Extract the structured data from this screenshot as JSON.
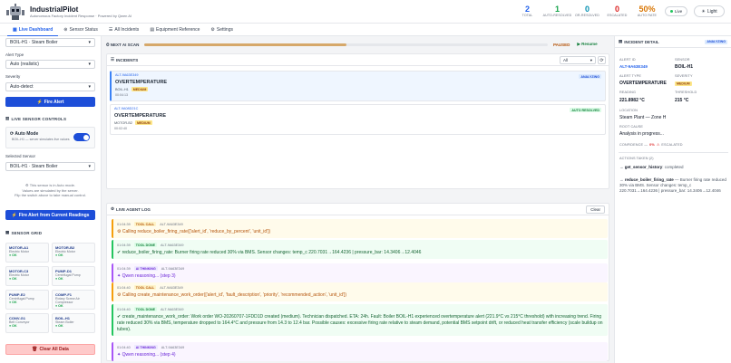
{
  "app": {
    "title": "IndustrialPilot",
    "subtitle": "Autonomous Factory Incident Response · Powered by Qwen AI"
  },
  "stats": [
    {
      "value": "2",
      "label": "TOTAL",
      "color": "#2563eb"
    },
    {
      "value": "1",
      "label": "AUTO-RESOLVED",
      "color": "#16a34a"
    },
    {
      "value": "0",
      "label": "OR-RESOLVED",
      "color": "#0891b2"
    },
    {
      "value": "0",
      "label": "ESCALATED",
      "color": "#dc2626"
    },
    {
      "value": "50%",
      "label": "AUTO RATE",
      "color": "#d97706"
    }
  ],
  "header": {
    "live_label": "Live",
    "theme_label": "Light"
  },
  "tabs": [
    "Live Dashboard",
    "Sensor Status",
    "All Incidents",
    "Equipment Reference",
    "Settings"
  ],
  "sidebar": {
    "equipment_select": "BOIL-H1 · Steam Boiler",
    "alert_type_label": "Alert Type",
    "alert_type_value": "Auto (realistic)",
    "severity_label": "Severity",
    "severity_value": "Auto-detect",
    "fire_alert_label": "Fire Alert",
    "live_controls_title": "LIVE SENSOR CONTROLS",
    "auto_mode_label": "Auto Mode",
    "auto_mode_desc": "BOIL-H1 — server simulates live values",
    "selected_sensor_label": "Selected Sensor",
    "selected_sensor_value": "BOIL-H1 · Steam Boiler",
    "note_line1": "This sensor is in Auto mode.",
    "note_line2": "Values are simulated by the server.",
    "note_line3": "Flip the switch above to take manual control.",
    "fire_current_label": "Fire Alert from Current Readings",
    "sensor_grid_title": "SENSOR GRID",
    "sensor_grid": [
      {
        "id": "MOTOR-A1",
        "type": "Electric Motor",
        "status": "OK"
      },
      {
        "id": "MOTOR-B2",
        "type": "Electric Motor",
        "status": "OK"
      },
      {
        "id": "MOTOR-C3",
        "type": "Electric Motor",
        "status": "OK"
      },
      {
        "id": "PUMP-D1",
        "type": "Centrifugal Pump",
        "status": "OK"
      },
      {
        "id": "PUMP-E2",
        "type": "Centrifugal Pump",
        "status": "OK"
      },
      {
        "id": "COMP-F1",
        "type": "Rotary Screw Air Compressor",
        "status": "OK"
      },
      {
        "id": "CONV-G1",
        "type": "Belt Conveyor",
        "status": "OK"
      },
      {
        "id": "BOIL-H1",
        "type": "Steam Boiler",
        "status": "OK"
      }
    ],
    "clear_label": "Clear All Data"
  },
  "scan": {
    "label": "NEXT AI SCAN",
    "progress": 0.5,
    "status": "PAUSED",
    "resume_label": "Resume"
  },
  "incidents": {
    "title": "INCIDENTS",
    "filter_value": "All",
    "items": [
      {
        "id": "ALT-9A63E349",
        "title": "OVERTEMPERATURE",
        "equipment": "BOIL-H1",
        "severity": "MEDIUM",
        "time": "00:04:13",
        "status": "ANALYZING"
      },
      {
        "id": "ALT-9A08D21C",
        "title": "OVERTEMPERATURE",
        "equipment": "MOTOR-B2",
        "severity": "MEDIUM",
        "time": "00:02:40",
        "status": "AUTO RESOLVED"
      }
    ]
  },
  "log": {
    "title": "LIVE AGENT LOG",
    "clear_label": "Clear",
    "entries": [
      {
        "time": "01:04:39",
        "tag": "TOOL CALL",
        "id": "ALT-9A63E349",
        "kind": "tool",
        "msg": "Calling reduce_boiler_firing_rate(['alert_id', 'reduce_by_percent', 'unit_id'])"
      },
      {
        "time": "01:04:39",
        "tag": "TOOL DONE",
        "id": "ALT-9A63E349",
        "kind": "done",
        "msg": "reduce_boiler_firing_rate: Burner firing rate reduced 30% via BMS. Sensor changes: temp_c 220.7031→164.4236 | pressure_bar: 14.3406→12.4046"
      },
      {
        "time": "01:04:39",
        "tag": "AI THINKING",
        "id": "ALT-9A63E349",
        "kind": "ai",
        "msg": "Qwen reasoning... (step 3)"
      },
      {
        "time": "01:04:40",
        "tag": "TOOL CALL",
        "id": "ALT-9A63E349",
        "kind": "tool",
        "msg": "Calling create_maintenance_work_order(['alert_id', 'fault_description', 'priority', 'recommended_action', 'unit_id'])"
      },
      {
        "time": "01:04:40",
        "tag": "TOOL DONE",
        "id": "ALT-9A63E349",
        "kind": "done",
        "msg": "create_maintenance_work_order: Work order WO-20260707-1FDD1D created (medium). Technician dispatched. ETA: 24h. Fault: Boiler BOIL-H1 experienced overtemperature alert (221.9°C vs 215°C threshold) with increasing trend. Firing rate reduced 30% via BMS, temperature dropped to 164.4°C and pressure from 14.3 to 12.4 bar. Possible causes: excessive firing rate relative to steam demand, potential BMS setpoint drift, or reduced heat transfer efficiency (scale buildup on tubes)."
      },
      {
        "time": "01:04:40",
        "tag": "AI THINKING",
        "id": "ALT-9A63E349",
        "kind": "ai",
        "msg": "Qwen reasoning... (step 4)"
      }
    ]
  },
  "detail": {
    "title": "INCIDENT DETAIL",
    "status": "ANALYZING",
    "alert_id_label": "ALERT ID",
    "alert_id": "ALT-9A63E349",
    "sensor_label": "SENSOR",
    "sensor": "BOIL-H1",
    "alert_type_label": "ALERT TYPE",
    "alert_type": "OVERTEMPERATURE",
    "severity_label": "SEVERITY",
    "severity": "MEDIUM",
    "reading_label": "READING",
    "reading": "221.8982 °C",
    "threshold_label": "THRESHOLD",
    "threshold": "215 °C",
    "location_label": "LOCATION",
    "location": "Steam Plant — Zone H",
    "root_cause_label": "ROOT CAUSE",
    "root_cause": "Analysis in progress...",
    "confidence_label": "CONFIDENCE —",
    "confidence_value": "0%",
    "escalated_label": "ESCALATED",
    "actions_label": "ACTIONS TAKEN (2)",
    "actions": [
      {
        "name": "get_sensor_history",
        "result": ": completed"
      },
      {
        "name": "reduce_boiler_firing_rate",
        "result": " — Burner firing rate reduced 30% via BMS. Sensor changes: temp_c 220.7031→164.4236 | pressure_bar: 14.3406→12.4046"
      }
    ]
  },
  "colors": {
    "accent": "#2563eb",
    "primary_button": "#1d4ed8",
    "danger_bg": "#fecaca"
  }
}
